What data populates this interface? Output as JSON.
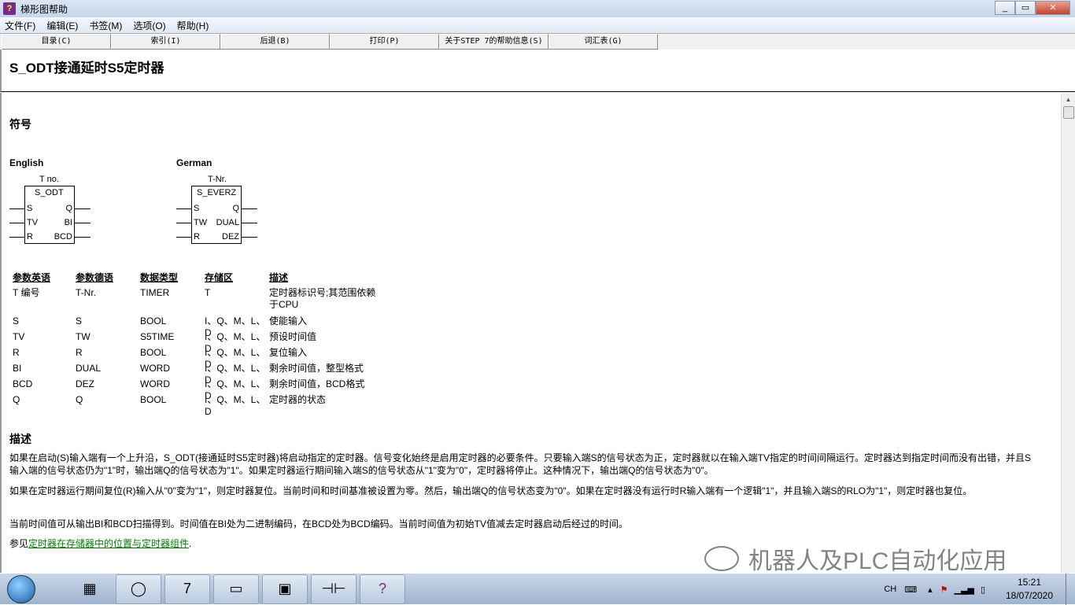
{
  "window": {
    "title": "梯形图帮助",
    "buttons": [
      "_",
      "▭",
      "✕"
    ]
  },
  "menu": [
    "文件(F)",
    "编辑(E)",
    "书签(M)",
    "选项(O)",
    "帮助(H)"
  ],
  "toolbar": [
    "目录(C)",
    "索引(I)",
    "后退(B)",
    "打印(P)",
    "关于STEP 7的帮助信息(S)",
    "词汇表(G)"
  ],
  "page": {
    "title": "S_ODT接通延时S5定时器",
    "symbol_heading": "符号",
    "english": {
      "label": "English",
      "tno": "T no.",
      "name": "S_ODT",
      "in": [
        "S",
        "TV",
        "R"
      ],
      "out": [
        "Q",
        "BI",
        "BCD"
      ]
    },
    "german": {
      "label": "German",
      "tno": "T-Nr.",
      "name": "S_EVERZ",
      "in": [
        "S",
        "TW",
        "R"
      ],
      "out": [
        "Q",
        "DUAL",
        "DEZ"
      ]
    },
    "table": {
      "headers": [
        "参数英语",
        "参数德语",
        "数据类型",
        "存储区",
        "描述"
      ],
      "rows": [
        [
          "T 编号",
          "T-Nr.",
          "TIMER",
          "T",
          "定时器标识号;其范围依赖于CPU"
        ],
        [
          "S",
          "S",
          "BOOL",
          "I、Q、M、L、D",
          "使能输入"
        ],
        [
          "TV",
          "TW",
          "S5TIME",
          "I、Q、M、L、D",
          "预设时间值"
        ],
        [
          "R",
          "R",
          "BOOL",
          "I、Q、M、L、D",
          "复位输入"
        ],
        [
          "BI",
          "DUAL",
          "WORD",
          "I、Q、M、L、D",
          "剩余时间值，整型格式"
        ],
        [
          "BCD",
          "DEZ",
          "WORD",
          "I、Q、M、L、D",
          "剩余时间值，BCD格式"
        ],
        [
          "Q",
          "Q",
          "BOOL",
          "I、Q、M、L、D",
          "定时器的状态"
        ]
      ]
    },
    "desc_heading": "描述",
    "p1": "如果在启动(S)输入端有一个上升沿，S_ODT(接通延时S5定时器)将启动指定的定时器。信号变化始终是启用定时器的必要条件。只要输入端S的信号状态为正，定时器就以在输入端TV指定的时间间隔运行。定时器达到指定时间而没有出错，并且S输入端的信号状态仍为\"1\"时，输出端Q的信号状态为\"1\"。如果定时器运行期间输入端S的信号状态从\"1\"变为\"0\"，定时器将停止。这种情况下，输出端Q的信号状态为\"0\"。",
    "p2": "如果在定时器运行期间复位(R)输入从\"0\"变为\"1\"，则定时器复位。当前时间和时间基准被设置为零。然后，输出端Q的信号状态变为\"0\"。如果在定时器没有运行时R输入端有一个逻辑\"1\"，并且输入端S的RLO为\"1\"，则定时器也复位。",
    "p3": "当前时间值可从输出BI和BCD扫描得到。时间值在BI处为二进制编码，在BCD处为BCD编码。当前时间值为初始TV值减去定时器启动后经过的时间。",
    "see_prefix": "参见",
    "see_link": "定时器在存储器中的位置与定时器组件",
    "see_suffix": "."
  },
  "watermark": "机器人及PLC自动化应用",
  "tray": {
    "lang": "CH",
    "time": "15:21",
    "date": "18/07/2020"
  }
}
